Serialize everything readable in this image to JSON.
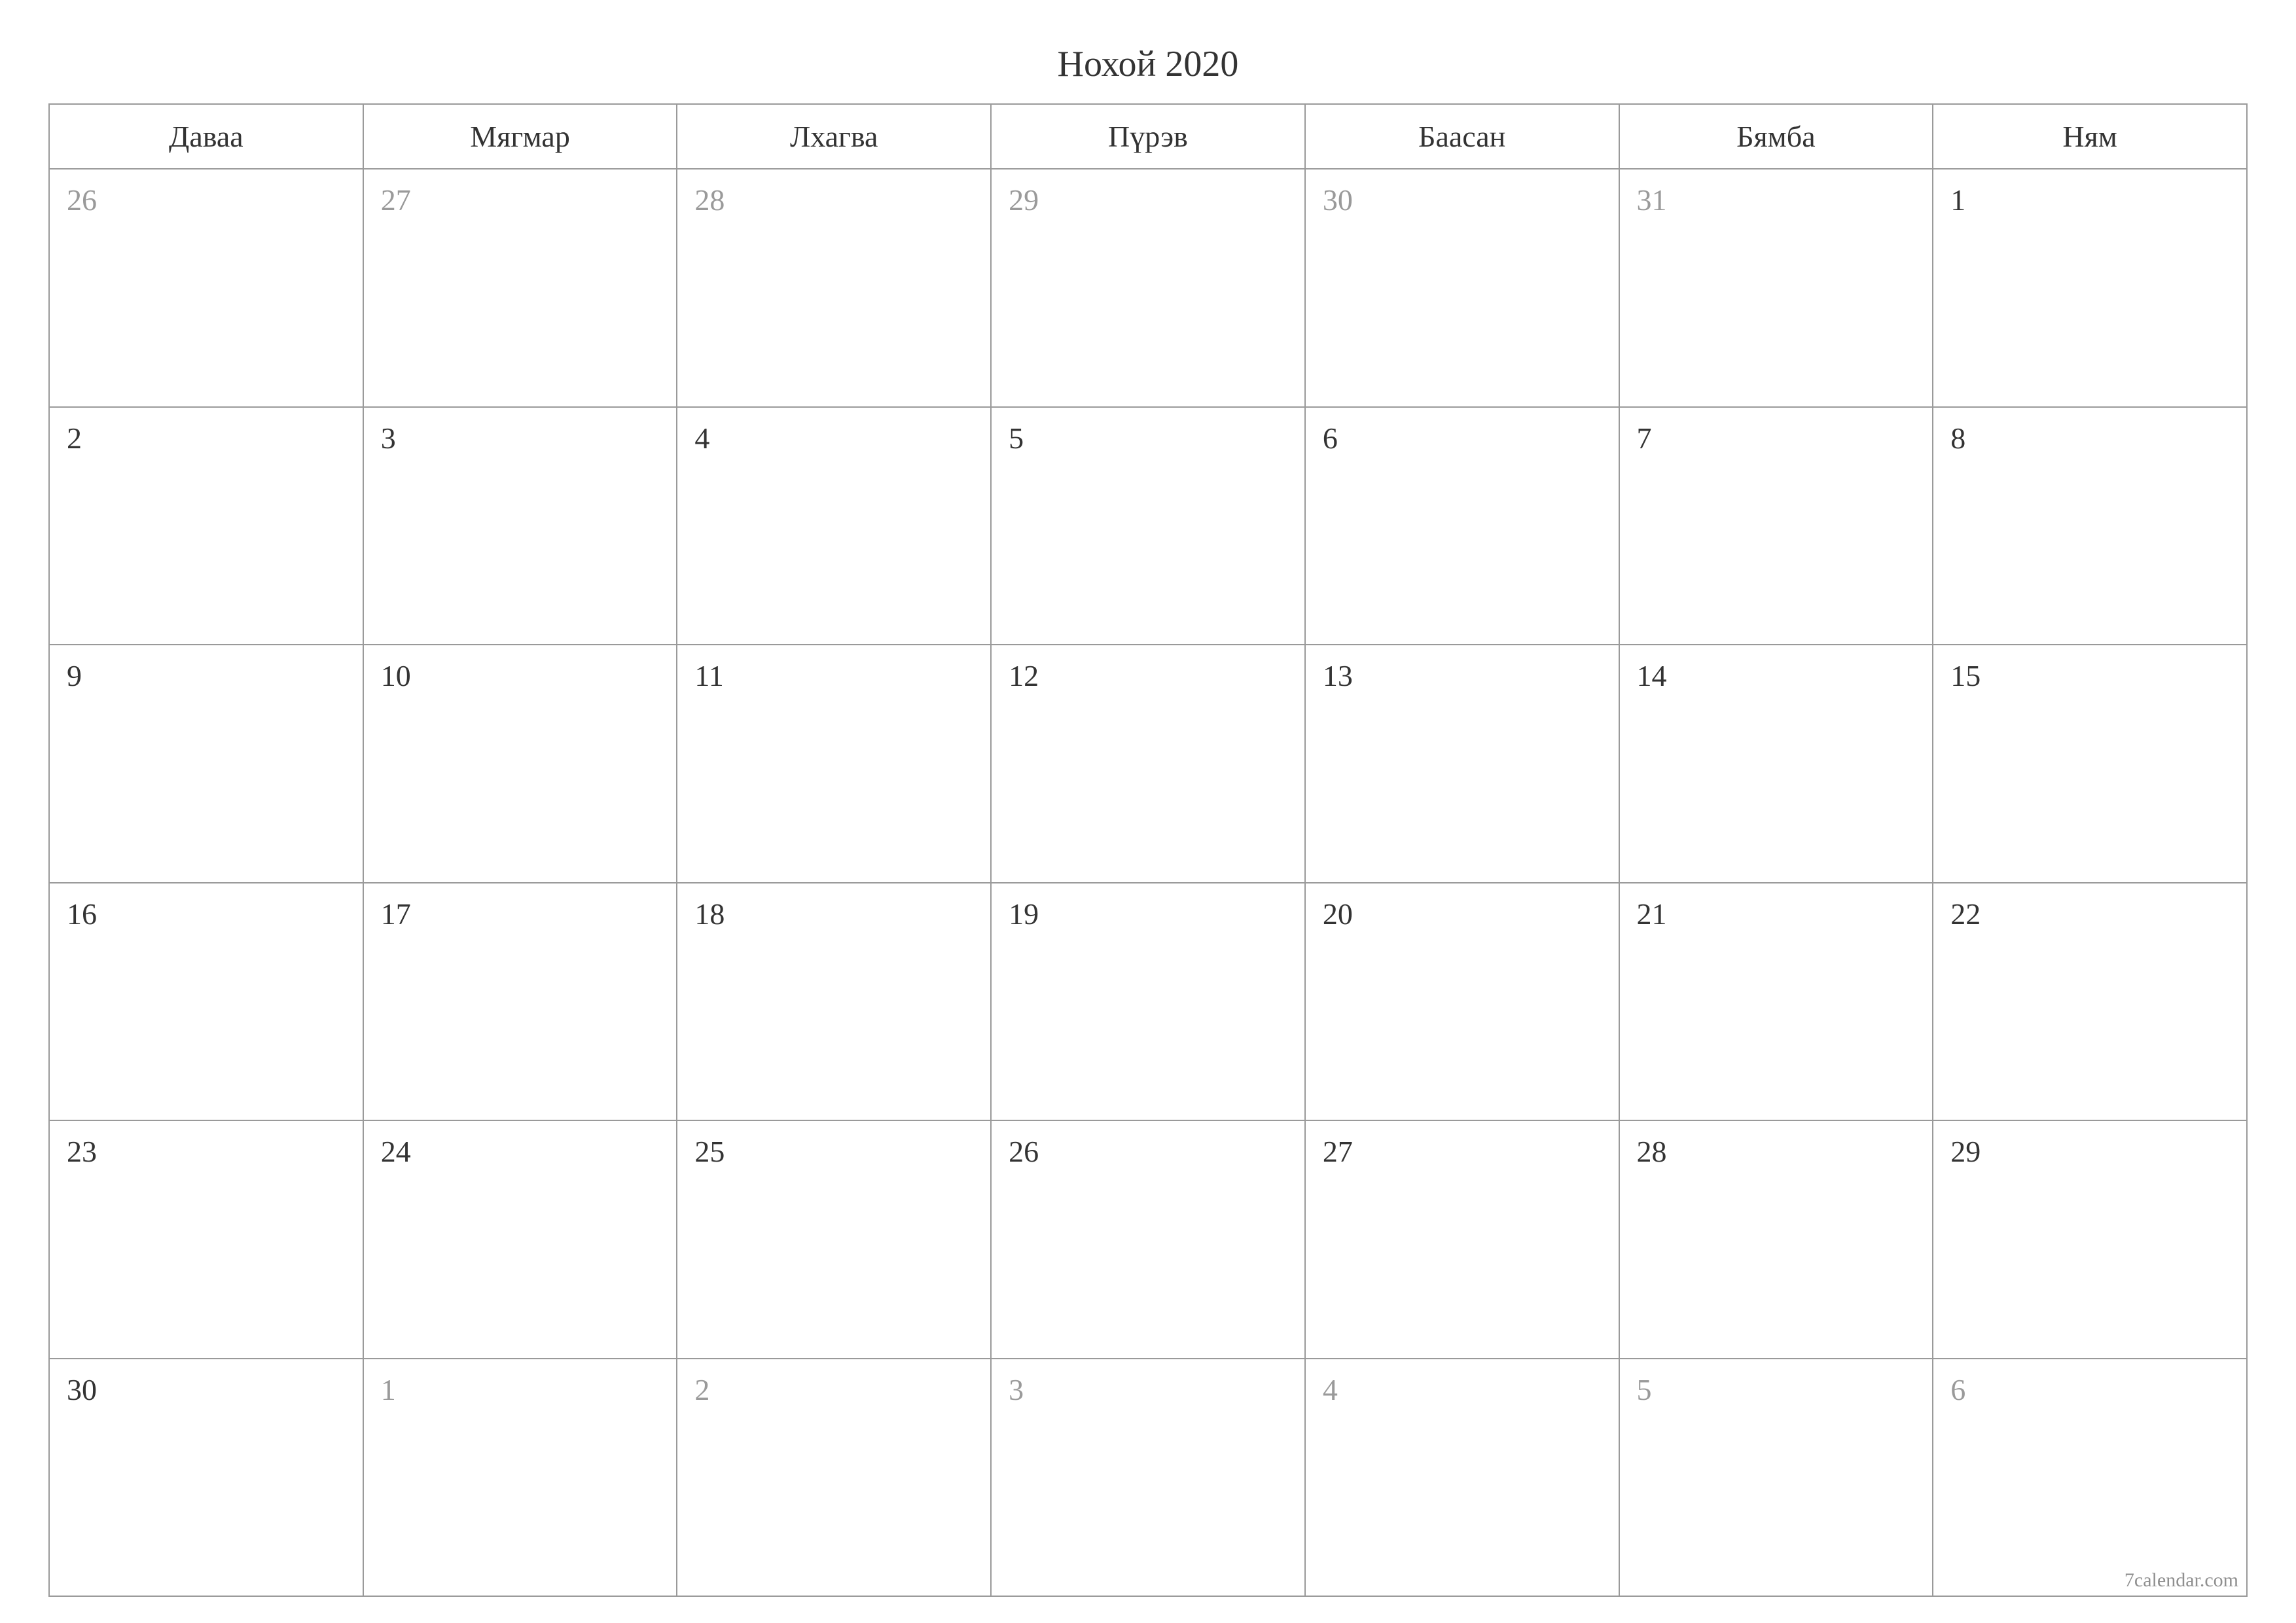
{
  "title": "Нохой 2020",
  "weekdays": [
    "Даваа",
    "Мягмар",
    "Лхагва",
    "Пүрэв",
    "Баасан",
    "Бямба",
    "Ням"
  ],
  "weeks": [
    [
      {
        "d": "26",
        "other": true
      },
      {
        "d": "27",
        "other": true
      },
      {
        "d": "28",
        "other": true
      },
      {
        "d": "29",
        "other": true
      },
      {
        "d": "30",
        "other": true
      },
      {
        "d": "31",
        "other": true
      },
      {
        "d": "1",
        "other": false
      }
    ],
    [
      {
        "d": "2",
        "other": false
      },
      {
        "d": "3",
        "other": false
      },
      {
        "d": "4",
        "other": false
      },
      {
        "d": "5",
        "other": false
      },
      {
        "d": "6",
        "other": false
      },
      {
        "d": "7",
        "other": false
      },
      {
        "d": "8",
        "other": false
      }
    ],
    [
      {
        "d": "9",
        "other": false
      },
      {
        "d": "10",
        "other": false
      },
      {
        "d": "11",
        "other": false
      },
      {
        "d": "12",
        "other": false
      },
      {
        "d": "13",
        "other": false
      },
      {
        "d": "14",
        "other": false
      },
      {
        "d": "15",
        "other": false
      }
    ],
    [
      {
        "d": "16",
        "other": false
      },
      {
        "d": "17",
        "other": false
      },
      {
        "d": "18",
        "other": false
      },
      {
        "d": "19",
        "other": false
      },
      {
        "d": "20",
        "other": false
      },
      {
        "d": "21",
        "other": false
      },
      {
        "d": "22",
        "other": false
      }
    ],
    [
      {
        "d": "23",
        "other": false
      },
      {
        "d": "24",
        "other": false
      },
      {
        "d": "25",
        "other": false
      },
      {
        "d": "26",
        "other": false
      },
      {
        "d": "27",
        "other": false
      },
      {
        "d": "28",
        "other": false
      },
      {
        "d": "29",
        "other": false
      }
    ],
    [
      {
        "d": "30",
        "other": false
      },
      {
        "d": "1",
        "other": true
      },
      {
        "d": "2",
        "other": true
      },
      {
        "d": "3",
        "other": true
      },
      {
        "d": "4",
        "other": true
      },
      {
        "d": "5",
        "other": true
      },
      {
        "d": "6",
        "other": true
      }
    ]
  ],
  "footer": "7calendar.com"
}
